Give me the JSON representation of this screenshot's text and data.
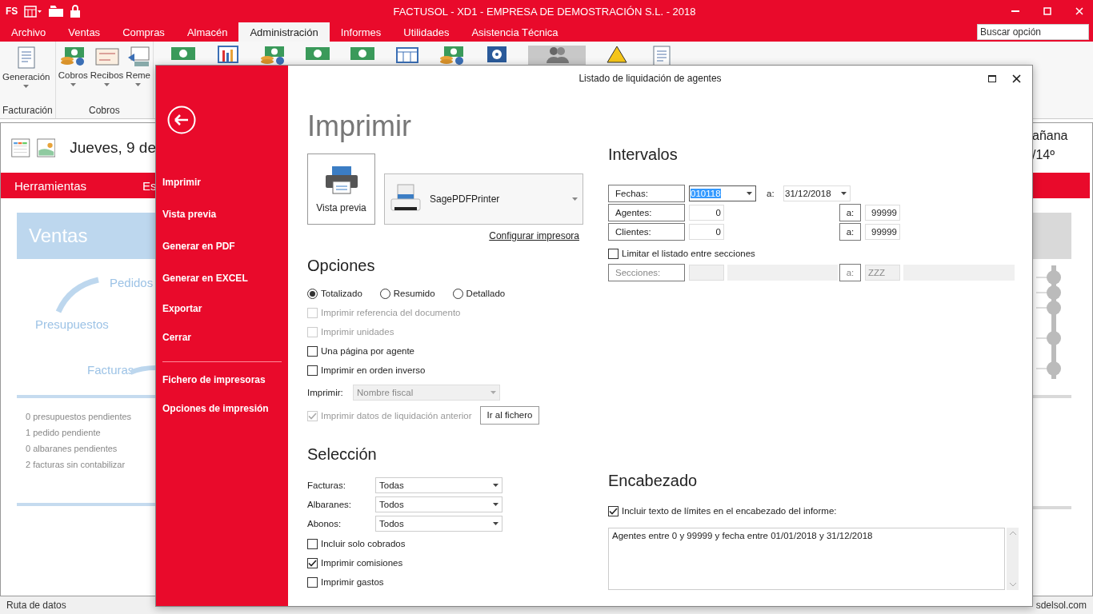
{
  "app": {
    "logo": "FS",
    "title": "FACTUSOL - XD1 - EMPRESA DE DEMOSTRACIÓN S.L. - 2018"
  },
  "menu_tabs": [
    {
      "label": "Archivo",
      "selected": false
    },
    {
      "label": "Ventas",
      "selected": false
    },
    {
      "label": "Compras",
      "selected": false
    },
    {
      "label": "Almacén",
      "selected": false
    },
    {
      "label": "Administración",
      "selected": true
    },
    {
      "label": "Informes",
      "selected": false
    },
    {
      "label": "Utilidades",
      "selected": false
    },
    {
      "label": "Asistencia Técnica",
      "selected": false
    }
  ],
  "search": {
    "placeholder": "Buscar opción"
  },
  "ribbon": {
    "groups": [
      {
        "label": "Facturación",
        "items": [
          {
            "label": "Generación",
            "kind": "document"
          }
        ]
      },
      {
        "label": "Cobros",
        "items": [
          {
            "label": "Cobros",
            "kind": "coins"
          },
          {
            "label": "Recibos",
            "kind": "receipt"
          },
          {
            "label": "Reme",
            "kind": "transfer"
          }
        ]
      }
    ],
    "icons": [
      {
        "kind": "bill",
        "selected": false
      },
      {
        "kind": "chart",
        "selected": false
      },
      {
        "kind": "coins",
        "selected": false
      },
      {
        "kind": "bill",
        "selected": false
      },
      {
        "kind": "bill",
        "selected": false
      },
      {
        "kind": "calendar",
        "selected": false
      },
      {
        "kind": "coins",
        "selected": false
      },
      {
        "kind": "safe",
        "selected": false
      },
      {
        "kind": "people",
        "selected": true
      },
      {
        "kind": "warning",
        "selected": false
      },
      {
        "kind": "document",
        "selected": false
      }
    ]
  },
  "dashboard": {
    "date": "Jueves, 9 de",
    "weather": [
      "añana",
      "/14º"
    ],
    "section_tabs": [
      "Herramientas",
      "Es"
    ],
    "panel_title": "Ventas",
    "flow": [
      "Pedidos",
      "Presupuestos",
      "Facturas"
    ],
    "pending": [
      "0 presupuestos pendientes",
      "1 pedido pendiente",
      "0 albaranes pendientes",
      "2 facturas sin contabilizar"
    ]
  },
  "status_bar": {
    "left": "Ruta de datos",
    "right": "sdelsol.com"
  },
  "dialog": {
    "title": "Listado de liquidación de agentes",
    "sidebar": {
      "groups": [
        [
          "Imprimir",
          "Vista previa",
          "Generar en PDF",
          "Generar en EXCEL",
          "Exportar",
          "Cerrar"
        ],
        [
          "Fichero de impresoras",
          "Opciones de impresión"
        ]
      ]
    },
    "heading": "Imprimir",
    "preview_button": "Vista previa",
    "printer": "SagePDFPrinter",
    "configure_link": "Configurar impresora",
    "options": {
      "heading": "Opciones",
      "radios": [
        {
          "label": "Totalizado",
          "selected": true
        },
        {
          "label": "Resumido",
          "selected": false
        },
        {
          "label": "Detallado",
          "selected": false
        }
      ],
      "checkboxes": [
        {
          "label": "Imprimir referencia del documento",
          "checked": false,
          "disabled": true
        },
        {
          "label": "Imprimir unidades",
          "checked": false,
          "disabled": true
        },
        {
          "label": "Una página por agente",
          "checked": false,
          "disabled": false
        },
        {
          "label": "Imprimir en orden inverso",
          "checked": false,
          "disabled": false
        }
      ],
      "print_field": {
        "label": "Imprimir:",
        "value": "Nombre fiscal",
        "disabled": true
      },
      "previous": {
        "label": "Imprimir datos de liquidación anterior",
        "checked": true,
        "disabled": true
      },
      "file_button": "Ir al fichero"
    },
    "selection": {
      "heading": "Selección",
      "selects": [
        {
          "label": "Facturas:",
          "value": "Todas"
        },
        {
          "label": "Albaranes:",
          "value": "Todos"
        },
        {
          "label": "Abonos:",
          "value": "Todos"
        }
      ],
      "checkboxes": [
        {
          "label": "Incluir solo cobrados",
          "checked": false
        },
        {
          "label": "Imprimir comisiones",
          "checked": true
        },
        {
          "label": "Imprimir gastos",
          "checked": false
        }
      ]
    },
    "intervals": {
      "heading": "Intervalos",
      "rows": [
        {
          "kind": "date",
          "label": "Fechas:",
          "from": "010118",
          "to_label": "a:",
          "to": "31/12/2018",
          "text_selected": true
        },
        {
          "kind": "number",
          "label": "Agentes:",
          "from": "0",
          "to_label": "a:",
          "to": "99999",
          "text_selected": false
        },
        {
          "kind": "number",
          "label": "Clientes:",
          "from": "0",
          "to_label": "a:",
          "to": "99999",
          "text_selected": false
        }
      ],
      "limit": {
        "label": "Limitar el listado entre secciones",
        "checked": false
      },
      "sections": {
        "label": "Secciones:",
        "to_label": "a:",
        "to": "ZZZ",
        "disabled": true
      }
    },
    "header": {
      "heading": "Encabezado",
      "checkbox": {
        "label": "Incluir texto de límites en el encabezado del informe:",
        "checked": true
      },
      "text": "Agentes entre 0 y 99999 y fecha entre 01/01/2018 y 31/12/2018"
    }
  }
}
